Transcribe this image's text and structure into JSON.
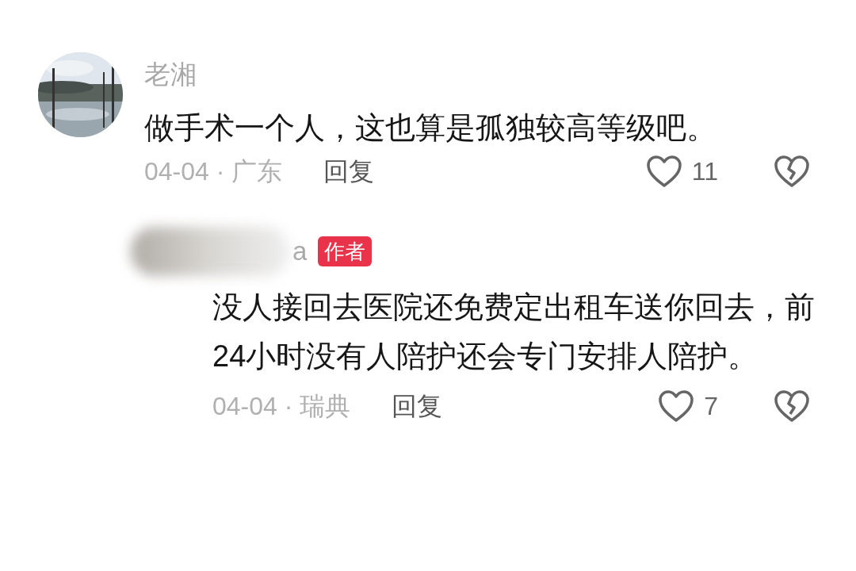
{
  "comments": [
    {
      "username": "老湘",
      "text": "做手术一个人，这也算是孤独较高等级吧。",
      "meta": "04-04 · 广东",
      "reply_label": "回复",
      "likes": "11",
      "children": [
        {
          "username": "a",
          "avatar": {
            "kind": "blurred"
          },
          "badge": "作者",
          "text": "没人接回去医院还免费定出租车送你回去，前24小时没有人陪护还会专门安排人陪护。",
          "meta": "04-04 · 瑞典",
          "reply_label": "回复",
          "likes": "7"
        }
      ]
    }
  ]
}
